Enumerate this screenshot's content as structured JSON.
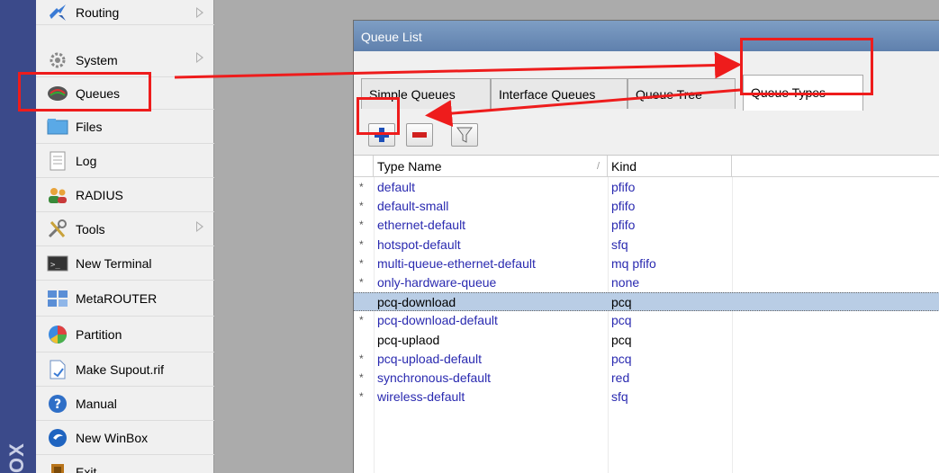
{
  "brand": {
    "text": "OX"
  },
  "sidebar": {
    "items": [
      {
        "label": "Routing",
        "icon": "routing-icon",
        "submenu": true
      },
      {
        "label": "System",
        "icon": "gear-icon",
        "submenu": true
      },
      {
        "label": "Queues",
        "icon": "queues-icon",
        "submenu": false
      },
      {
        "label": "Files",
        "icon": "folder-icon",
        "submenu": false
      },
      {
        "label": "Log",
        "icon": "log-icon",
        "submenu": false
      },
      {
        "label": "RADIUS",
        "icon": "users-icon",
        "submenu": false
      },
      {
        "label": "Tools",
        "icon": "tools-icon",
        "submenu": true
      },
      {
        "label": "New Terminal",
        "icon": "terminal-icon",
        "submenu": false
      },
      {
        "label": "MetaROUTER",
        "icon": "metarouter-icon",
        "submenu": false
      },
      {
        "label": "Partition",
        "icon": "pie-icon",
        "submenu": false
      },
      {
        "label": "Make Supout.rif",
        "icon": "file-icon",
        "submenu": false
      },
      {
        "label": "Manual",
        "icon": "help-icon",
        "submenu": false
      },
      {
        "label": "New WinBox",
        "icon": "winbox-icon",
        "submenu": false
      },
      {
        "label": "Exit",
        "icon": "exit-icon",
        "submenu": false
      }
    ]
  },
  "window": {
    "title": "Queue List",
    "tabs": [
      {
        "label": "Simple Queues"
      },
      {
        "label": "Interface Queues"
      },
      {
        "label": "Queue Tree"
      },
      {
        "label": "Queue Types"
      }
    ],
    "toolbar": {
      "add": "add-icon",
      "remove": "remove-icon",
      "filter": "filter-icon"
    },
    "table": {
      "columns": [
        "Type Name",
        "Kind"
      ],
      "rows": [
        {
          "mark": "*",
          "name": "default",
          "kind": "pfifo"
        },
        {
          "mark": "*",
          "name": "default-small",
          "kind": "pfifo"
        },
        {
          "mark": "*",
          "name": "ethernet-default",
          "kind": "pfifo"
        },
        {
          "mark": "*",
          "name": "hotspot-default",
          "kind": "sfq"
        },
        {
          "mark": "*",
          "name": "multi-queue-ethernet-default",
          "kind": "mq pfifo"
        },
        {
          "mark": "*",
          "name": "only-hardware-queue",
          "kind": "none"
        },
        {
          "mark": "",
          "name": "pcq-download",
          "kind": "pcq"
        },
        {
          "mark": "*",
          "name": "pcq-download-default",
          "kind": "pcq"
        },
        {
          "mark": "",
          "name": "pcq-uplaod",
          "kind": "pcq"
        },
        {
          "mark": "*",
          "name": "pcq-upload-default",
          "kind": "pcq"
        },
        {
          "mark": "*",
          "name": "synchronous-default",
          "kind": "red"
        },
        {
          "mark": "*",
          "name": "wireless-default",
          "kind": "sfq"
        }
      ]
    }
  },
  "colors": {
    "annotation": "#ee1c1c",
    "selected_row": "#b9cde5",
    "titlebar": "#6a8ab5",
    "default_row_text": "#2a2ab0"
  }
}
